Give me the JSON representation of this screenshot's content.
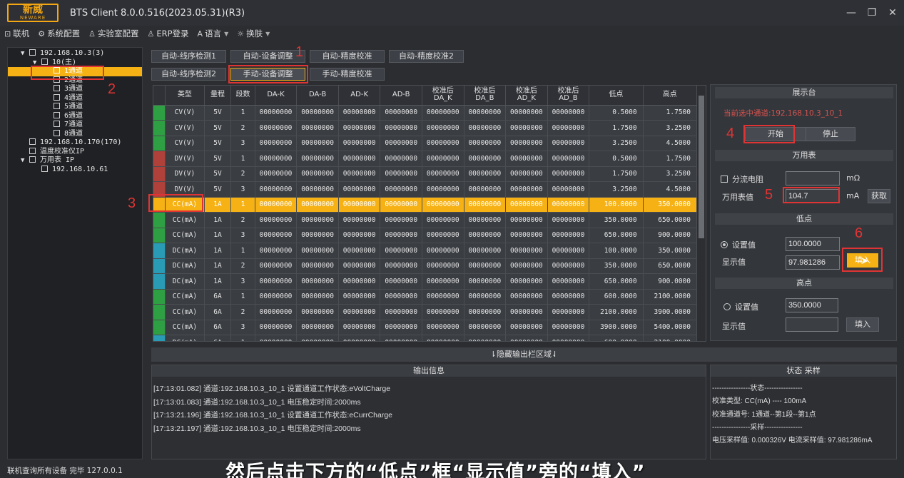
{
  "window": {
    "logo_cn": "新威",
    "logo_en": "NEWARE",
    "title": "BTS Client 8.0.0.516(2023.05.31)(R3)",
    "minimize": "—",
    "maximize": "❐",
    "close": "✕"
  },
  "menu": {
    "items": [
      {
        "icon": "⊡",
        "label": "联机"
      },
      {
        "icon": "⚙",
        "label": "系统配置"
      },
      {
        "icon": "♙",
        "label": "实验室配置"
      },
      {
        "icon": "♙",
        "label": "ERP登录"
      },
      {
        "icon": "A",
        "label": "语言"
      },
      {
        "icon": "☼",
        "label": "换肤"
      }
    ]
  },
  "tree": [
    {
      "label": "192.168.10.3(3)",
      "arrow": "▼",
      "indent": 0
    },
    {
      "label": "10(主)",
      "arrow": "▼",
      "indent": 1
    },
    {
      "label": "1通道",
      "arrow": "",
      "indent": 2,
      "selected": true
    },
    {
      "label": "2通道",
      "arrow": "",
      "indent": 2
    },
    {
      "label": "3通道",
      "arrow": "",
      "indent": 2
    },
    {
      "label": "4通道",
      "arrow": "",
      "indent": 2
    },
    {
      "label": "5通道",
      "arrow": "",
      "indent": 2
    },
    {
      "label": "6通道",
      "arrow": "",
      "indent": 2
    },
    {
      "label": "7通道",
      "arrow": "",
      "indent": 2
    },
    {
      "label": "8通道",
      "arrow": "",
      "indent": 2
    },
    {
      "label": "192.168.10.170(170)",
      "arrow": "",
      "indent": 0
    },
    {
      "label": "温度校准仪IP",
      "arrow": "",
      "indent": 0
    },
    {
      "label": "万用表 IP",
      "arrow": "▼",
      "indent": 0
    },
    {
      "label": "192.168.10.61",
      "arrow": "",
      "indent": 1
    }
  ],
  "tabs": {
    "row1": [
      "自动-线序检测1",
      "自动-设备调整",
      "自动-精度校准",
      "自动-精度校准2"
    ],
    "row2": [
      "自动-线序检测2",
      "手动-设备调整",
      "手动-精度校准"
    ]
  },
  "table": {
    "headers": [
      "类型",
      "量程",
      "段数",
      "DA-K",
      "DA-B",
      "AD-K",
      "AD-B",
      "校准后\nDA_K",
      "校准后\nDA_B",
      "校准后\nAD_K",
      "校准后\nAD_B",
      "低点",
      "高点"
    ],
    "rows": [
      {
        "color": "#2ea043",
        "cells": [
          "CV(V)",
          "5V",
          "1",
          "00000000",
          "00000000",
          "00000000",
          "00000000",
          "00000000",
          "00000000",
          "00000000",
          "00000000",
          "0.5000",
          "1.7500"
        ]
      },
      {
        "color": "#2ea043",
        "cells": [
          "CV(V)",
          "5V",
          "2",
          "00000000",
          "00000000",
          "00000000",
          "00000000",
          "00000000",
          "00000000",
          "00000000",
          "00000000",
          "1.7500",
          "3.2500"
        ]
      },
      {
        "color": "#2ea043",
        "cells": [
          "CV(V)",
          "5V",
          "3",
          "00000000",
          "00000000",
          "00000000",
          "00000000",
          "00000000",
          "00000000",
          "00000000",
          "00000000",
          "3.2500",
          "4.5000"
        ]
      },
      {
        "color": "#b0403a",
        "cells": [
          "DV(V)",
          "5V",
          "1",
          "00000000",
          "00000000",
          "00000000",
          "00000000",
          "00000000",
          "00000000",
          "00000000",
          "00000000",
          "0.5000",
          "1.7500"
        ]
      },
      {
        "color": "#b0403a",
        "cells": [
          "DV(V)",
          "5V",
          "2",
          "00000000",
          "00000000",
          "00000000",
          "00000000",
          "00000000",
          "00000000",
          "00000000",
          "00000000",
          "1.7500",
          "3.2500"
        ]
      },
      {
        "color": "#b0403a",
        "cells": [
          "DV(V)",
          "5V",
          "3",
          "00000000",
          "00000000",
          "00000000",
          "00000000",
          "00000000",
          "00000000",
          "00000000",
          "00000000",
          "3.2500",
          "4.5000"
        ]
      },
      {
        "color": "#f6b215",
        "selected": true,
        "cells": [
          "CC(mA)",
          "1A",
          "1",
          "00000000",
          "00000000",
          "00000000",
          "00000000",
          "00000000",
          "00000000",
          "00000000",
          "00000000",
          "100.0000",
          "350.0000"
        ]
      },
      {
        "color": "#2ea043",
        "cells": [
          "CC(mA)",
          "1A",
          "2",
          "00000000",
          "00000000",
          "00000000",
          "00000000",
          "00000000",
          "00000000",
          "00000000",
          "00000000",
          "350.0000",
          "650.0000"
        ]
      },
      {
        "color": "#2ea043",
        "cells": [
          "CC(mA)",
          "1A",
          "3",
          "00000000",
          "00000000",
          "00000000",
          "00000000",
          "00000000",
          "00000000",
          "00000000",
          "00000000",
          "650.0000",
          "900.0000"
        ]
      },
      {
        "color": "#2a9bb5",
        "cells": [
          "DC(mA)",
          "1A",
          "1",
          "00000000",
          "00000000",
          "00000000",
          "00000000",
          "00000000",
          "00000000",
          "00000000",
          "00000000",
          "100.0000",
          "350.0000"
        ]
      },
      {
        "color": "#2a9bb5",
        "cells": [
          "DC(mA)",
          "1A",
          "2",
          "00000000",
          "00000000",
          "00000000",
          "00000000",
          "00000000",
          "00000000",
          "00000000",
          "00000000",
          "350.0000",
          "650.0000"
        ]
      },
      {
        "color": "#2a9bb5",
        "cells": [
          "DC(mA)",
          "1A",
          "3",
          "00000000",
          "00000000",
          "00000000",
          "00000000",
          "00000000",
          "00000000",
          "00000000",
          "00000000",
          "650.0000",
          "900.0000"
        ]
      },
      {
        "color": "#2ea043",
        "cells": [
          "CC(mA)",
          "6A",
          "1",
          "00000000",
          "00000000",
          "00000000",
          "00000000",
          "00000000",
          "00000000",
          "00000000",
          "00000000",
          "600.0000",
          "2100.0000"
        ]
      },
      {
        "color": "#2ea043",
        "cells": [
          "CC(mA)",
          "6A",
          "2",
          "00000000",
          "00000000",
          "00000000",
          "00000000",
          "00000000",
          "00000000",
          "00000000",
          "00000000",
          "2100.0000",
          "3900.0000"
        ]
      },
      {
        "color": "#2ea043",
        "cells": [
          "CC(mA)",
          "6A",
          "3",
          "00000000",
          "00000000",
          "00000000",
          "00000000",
          "00000000",
          "00000000",
          "00000000",
          "00000000",
          "3900.0000",
          "5400.0000"
        ]
      },
      {
        "color": "#2a9bb5",
        "cells": [
          "DC(mA)",
          "6A",
          "1",
          "00000000",
          "00000000",
          "00000000",
          "00000000",
          "00000000",
          "00000000",
          "00000000",
          "00000000",
          "600.0000",
          "2100.0000"
        ]
      }
    ]
  },
  "display": {
    "header": "展示台",
    "status": "当前选中通道:192.168.10.3_10_1",
    "start": "开始",
    "stop": "停止"
  },
  "multimeter": {
    "header": "万用表",
    "shunt_label": "分流电阻",
    "shunt_value": "",
    "shunt_unit": "mΩ",
    "meter_label": "万用表值",
    "meter_value": "104.7",
    "meter_unit": "mA",
    "fetch": "获取"
  },
  "low": {
    "header": "低点",
    "set_label": "设置值",
    "set_value": "100.0000",
    "show_label": "显示值",
    "show_value": "97.981286",
    "fill": "填入"
  },
  "high": {
    "header": "高点",
    "set_label": "设置值",
    "set_value": "350.0000",
    "show_label": "显示值",
    "show_value": "",
    "fill": "填入"
  },
  "annotations": [
    "1",
    "2",
    "3",
    "4",
    "5",
    "6"
  ],
  "output": {
    "hide_bar": "⇂隐藏输出栏区域⇃",
    "header": "输出信息",
    "lines": [
      "[17:13:01.082] 通道:192.168.10.3_10_1 设置通道工作状态:eVoltCharge",
      "[17:13:01.083] 通道:192.168.10.3_10_1 电压稳定时间:2000ms",
      "[17:13:21.196] 通道:192.168.10.3_10_1 设置通道工作状态:eCurrCharge",
      "[17:13:21.197] 通道:192.168.10.3_10_1 电压稳定时间:2000ms"
    ]
  },
  "status_panel": {
    "header": "状态 采样",
    "lines": [
      "----------------状态----------------",
      "校准类型: CC(mA) ---- 100mA",
      "校准通道号: 1通道--第1段--第1点",
      "----------------采样----------------",
      "电压采样值: 0.000326V  电流采样值: 97.981286mA"
    ]
  },
  "statusbar": "联机查询所有设备 完毕 127.0.0.1",
  "subtitle": "然后点击下方的“低点”框“显示值”旁的“填入”"
}
